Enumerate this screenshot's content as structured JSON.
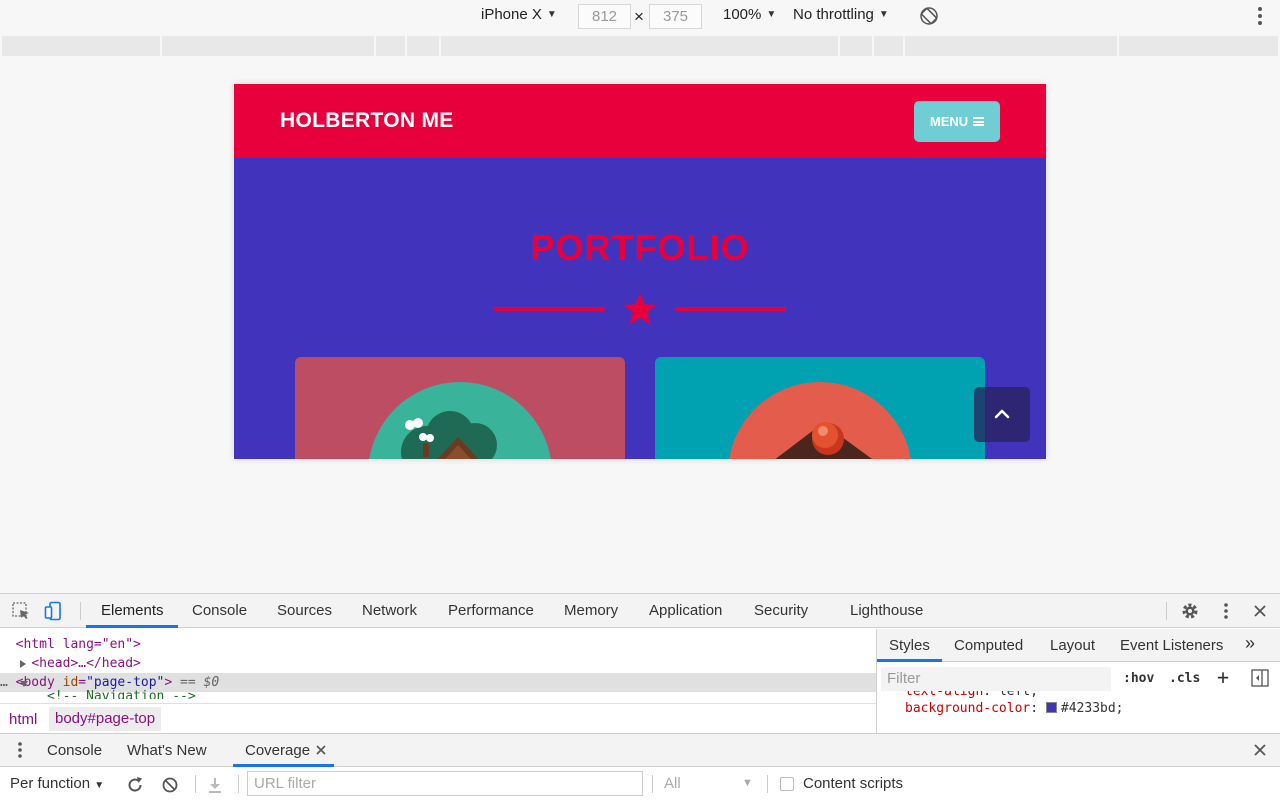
{
  "device_toolbar": {
    "device": "iPhone X",
    "width": "812",
    "height": "375",
    "times": "×",
    "zoom": "100%",
    "throttling": "No throttling"
  },
  "site": {
    "brand": "HOLBERTON ME",
    "menu_label": "MENU",
    "section_title": "PORTFOLIO",
    "colors": {
      "nav": "#e8003d",
      "background": "#4233bd",
      "menu_button": "#6fcdd3",
      "card1": "#bd4d63",
      "card2": "#00a2b2"
    }
  },
  "devtools": {
    "tabs": [
      "Elements",
      "Console",
      "Sources",
      "Network",
      "Performance",
      "Memory",
      "Application",
      "Security",
      "Lighthouse"
    ],
    "elements": {
      "line_html_open": "<html lang=\"en\">",
      "line_head": "<head>…</head>",
      "line_body_tag": "body",
      "line_body_attr": "id",
      "line_body_val": "\"page-top\"",
      "line_body_suffix": "== $0",
      "line_comment": "<!-- Navigation -->"
    },
    "breadcrumbs": [
      "html",
      "body#page-top"
    ],
    "styles_tabs": [
      "Styles",
      "Computed",
      "Layout",
      "Event Listeners"
    ],
    "filter_placeholder": "Filter",
    "hov": ":hov",
    "cls": ".cls",
    "css_lines": [
      {
        "prop": "text-align",
        "value": "left;"
      },
      {
        "prop": "background-color",
        "value": "#4233bd;"
      }
    ],
    "drawer_tabs": [
      "Console",
      "What's New",
      "Coverage"
    ],
    "coverage": {
      "mode": "Per function",
      "url_filter_placeholder": "URL filter",
      "type_select": "All",
      "content_scripts": "Content scripts"
    }
  }
}
